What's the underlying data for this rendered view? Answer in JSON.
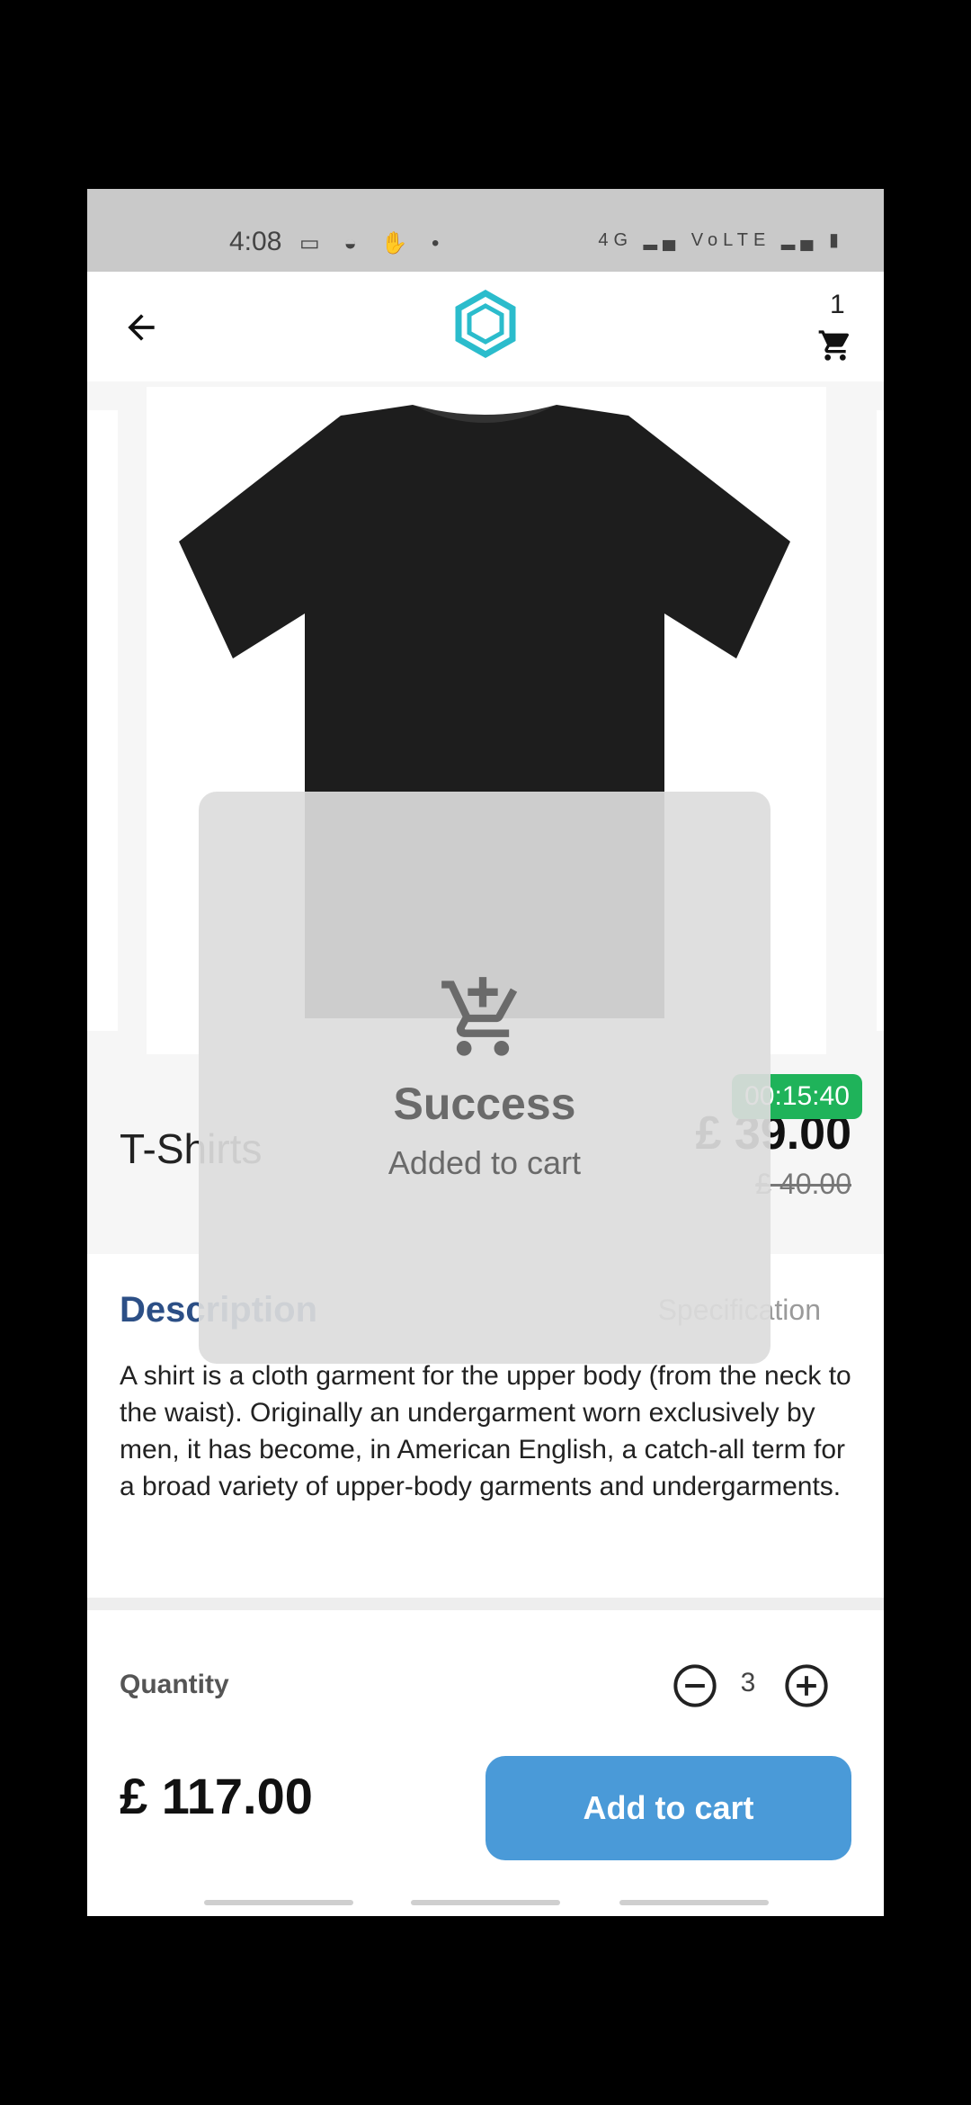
{
  "status_bar": {
    "time": "4:08",
    "left_icons": "▭ ◒ ✋ •",
    "right_icons": "4G ▂▄ VoLTE ▂▄ ▮"
  },
  "app_bar": {
    "cart_count": "1"
  },
  "product": {
    "name": "T-Shirts",
    "price": "£ 39.00",
    "old_price": "£ 40.00",
    "timer": "00:15:40"
  },
  "tabs": {
    "description": "Description",
    "specification": "Specification"
  },
  "description_text": "A shirt is a cloth garment for the upper body (from the neck to the waist). Originally an undergarment worn exclusively by men, it has become, in American English, a catch-all term for a broad variety of upper-body garments and undergarments.",
  "quantity": {
    "label": "Quantity",
    "value": "3"
  },
  "total": "£ 117.00",
  "add_to_cart_label": "Add to cart",
  "toast": {
    "title": "Success",
    "message": "Added to cart"
  },
  "colors": {
    "accent": "#4a9ad8",
    "tab_active": "#2c4f86",
    "timer": "#1fb35a",
    "logo": "#2bbccc"
  },
  "icons": [
    "back-arrow-icon",
    "logo-icon",
    "cart-icon",
    "minus-circle-icon",
    "plus-circle-icon",
    "cart-add-icon"
  ]
}
